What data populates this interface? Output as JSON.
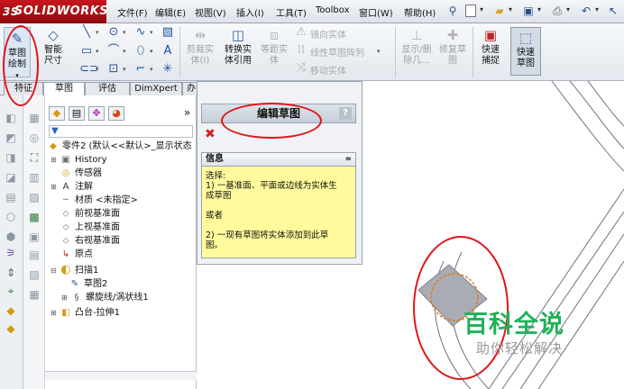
{
  "app": {
    "brand": "SOLIDWORKS",
    "brand_prefix": "3S"
  },
  "menu": {
    "file": "文件(F)",
    "edit": "编辑(E)",
    "view": "视图(V)",
    "insert": "插入(I)",
    "tools": "工具(T)",
    "toolbox": "Toolbox",
    "window": "窗口(W)",
    "help": "帮助(H)"
  },
  "quick_access": [
    "pin-icon",
    "new-document-icon",
    "open-icon",
    "save-icon",
    "print-icon",
    "undo-icon"
  ],
  "commands": {
    "sketch": "草图绘制",
    "smart_dim": "智能尺寸",
    "trim": "剪裁实体(I)",
    "convert": "转换实体引用",
    "offset": "等距实体",
    "mirror": "镜向实体",
    "linear_pattern": "线性草图阵列",
    "move": "移动实体",
    "display_delete": "显示/删除几...",
    "repair": "修复草图",
    "quick_snap": "快速捕捉",
    "rapid_sketch": "快速草图"
  },
  "tabs": [
    "特征",
    "草图",
    "评估",
    "DimXpert",
    "办公室产品"
  ],
  "feature_tree": {
    "filter_symbol": "▼",
    "expand_arrow": "»",
    "root": "零件2 (默认<<默认>_显示状态",
    "items": [
      {
        "label": "History"
      },
      {
        "label": "传感器"
      },
      {
        "label": "注解"
      },
      {
        "label": "材质 <未指定>"
      },
      {
        "label": "前视基准面"
      },
      {
        "label": "上视基准面"
      },
      {
        "label": "右视基准面"
      },
      {
        "label": "原点"
      },
      {
        "label": "扫描1"
      },
      {
        "label": "草图2"
      },
      {
        "label": "螺旋线/涡状线1"
      },
      {
        "label": "凸台-拉伸1"
      }
    ]
  },
  "property_manager": {
    "title": "编辑草图",
    "help_symbol": "?",
    "cancel_symbol": "✖",
    "info_header": "信息",
    "collapse_symbol": "≈",
    "info_lines": [
      "选择:",
      "1) 一基准面、平面或边线为实体生",
      "成草图",
      "",
      "或者",
      "",
      "2) 一现有草图将实体添加到此草",
      "图。"
    ]
  },
  "watermark": {
    "title": "百科全说",
    "subtitle": "助你轻松解决"
  },
  "colors": {
    "annotation_red": "#e0141a",
    "brand_red": "#c7161d",
    "watermark_green": "#21b15a",
    "info_yellow": "#fffb9c"
  }
}
